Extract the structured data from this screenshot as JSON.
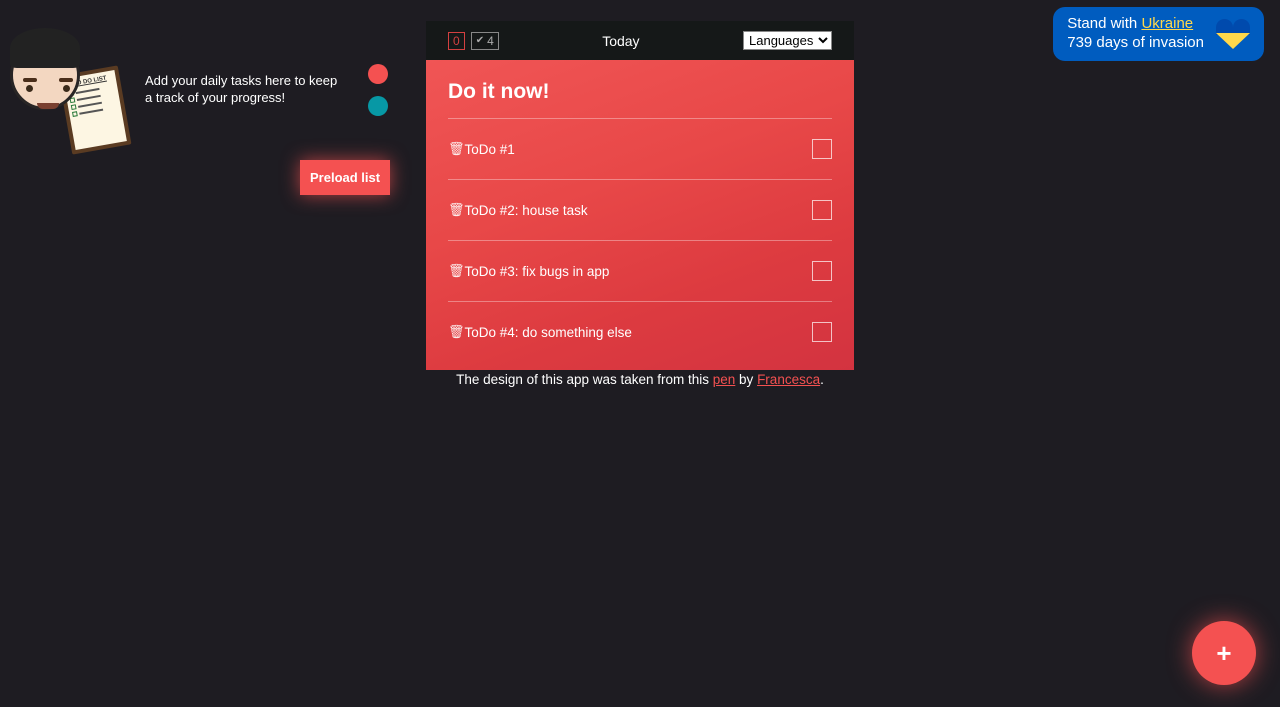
{
  "header": {
    "intro": "Add your daily tasks here to keep a track of your progress!",
    "note_title": "TO DO LIST"
  },
  "theme": {
    "colors": [
      "#f45151",
      "#0798a5"
    ]
  },
  "preload_button": "Preload list",
  "ukraine": {
    "line1_prefix": "Stand with ",
    "line1_link": "Ukraine",
    "line2": "739 days of invasion"
  },
  "card": {
    "top": {
      "done_count": "0",
      "todo_count": "4",
      "center_label": "Today",
      "lang_placeholder": "Languages"
    },
    "title": "Do it now!",
    "items": [
      {
        "text": "ToDo #1"
      },
      {
        "text": "ToDo #2: house task"
      },
      {
        "text": "ToDo #3: fix bugs in app"
      },
      {
        "text": "ToDo #4: do something else"
      }
    ]
  },
  "credit": {
    "prefix": "The design of this app was taken from this ",
    "link1": "pen",
    "mid": " by ",
    "link2": "Francesca",
    "suffix": "."
  },
  "fab": {
    "label": "+"
  }
}
